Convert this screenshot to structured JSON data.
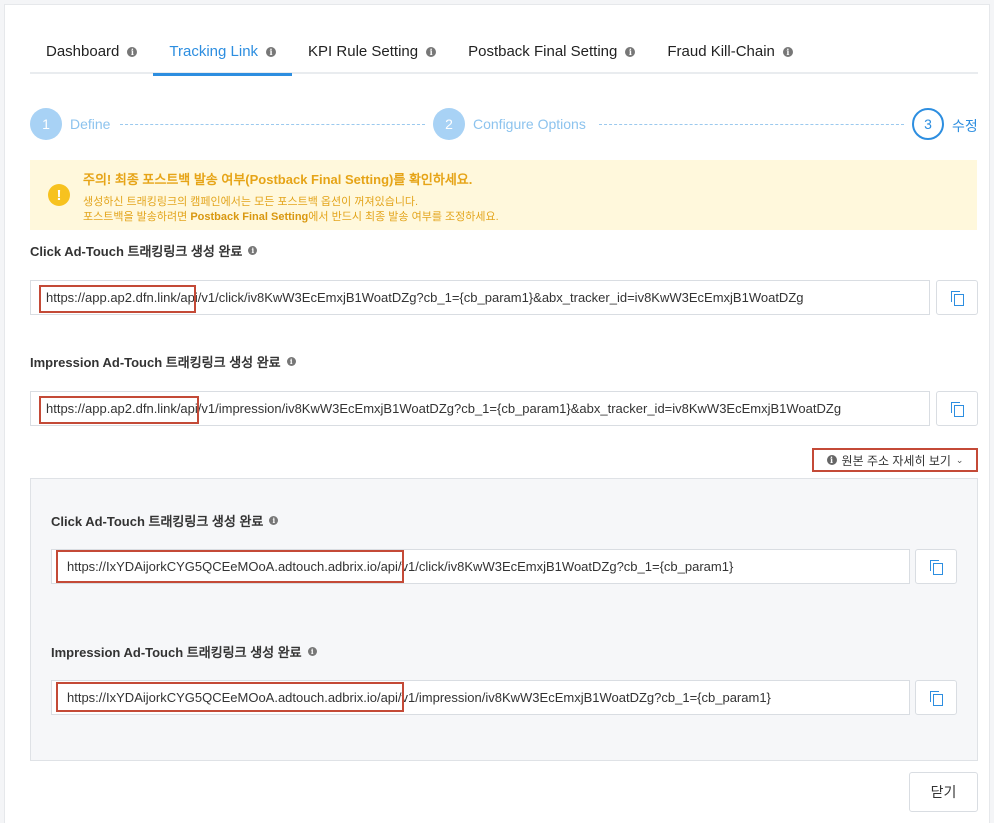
{
  "tabs": [
    {
      "label": "Dashboard",
      "active": false
    },
    {
      "label": "Tracking Link",
      "active": true
    },
    {
      "label": "KPI Rule Setting",
      "active": false
    },
    {
      "label": "Postback Final Setting",
      "active": false
    },
    {
      "label": "Fraud Kill-Chain",
      "active": false
    }
  ],
  "stepper": {
    "steps": [
      {
        "number": "1",
        "label": "Define",
        "state": "done"
      },
      {
        "number": "2",
        "label": "Configure Options",
        "state": "done"
      },
      {
        "number": "3",
        "label": "수정",
        "state": "current"
      }
    ]
  },
  "warning": {
    "icon": "!",
    "title": "주의! 최종 포스트백 발송 여부(Postback Final Setting)를 확인하세요.",
    "line1": "생성하신 트래킹링크의 캠페인에서는 모든 포스트백 옵션이 꺼져있습니다.",
    "line2_pre": "포스트백을 발송하려면 ",
    "line2_bold": "Postback Final Setting",
    "line2_post": "에서 반드시 최종 발송 여부를 조정하세요."
  },
  "click_link": {
    "label": "Click Ad-Touch 트래킹링크 생성 완료",
    "prefix": "https://app.ap2.dfn.link",
    "suffix": "/api/v1/click/iv8KwW3EcEmxjB1WoatDZg?cb_1={cb_param1}&abx_tracker_id=iv8KwW3EcEmxjB1WoatDZg"
  },
  "impression_link": {
    "label": "Impression Ad-Touch 트래킹링크 생성 완료",
    "prefix": "https://app.ap2.dfn.link",
    "suffix": "/api/v1/impression/iv8KwW3EcEmxjB1WoatDZg?cb_1={cb_param1}&abx_tracker_id=iv8KwW3EcEmxjB1WoatDZg"
  },
  "toggle": {
    "label": "원본 주소 자세히 보기",
    "chevron": "⌄"
  },
  "original_click_link": {
    "label": "Click Ad-Touch 트래킹링크 생성 완료",
    "prefix": "https://IxYDAijorkCYG5QCEeMOoA.adtouch.adbrix.io",
    "suffix": "/api/v1/click/iv8KwW3EcEmxjB1WoatDZg?cb_1={cb_param1}"
  },
  "original_impression_link": {
    "label": "Impression Ad-Touch 트래킹링크 생성 완료",
    "prefix": "https://IxYDAijorkCYG5QCEeMOoA.adtouch.adbrix.io",
    "suffix": "/api/v1/impression/iv8KwW3EcEmxjB1WoatDZg?cb_1={cb_param1}"
  },
  "buttons": {
    "close": "닫기"
  },
  "colors": {
    "accent": "#2d8ee0",
    "highlight": "#c44a37",
    "warning_bg": "#fff8dc",
    "warning_text": "#e6a417"
  }
}
